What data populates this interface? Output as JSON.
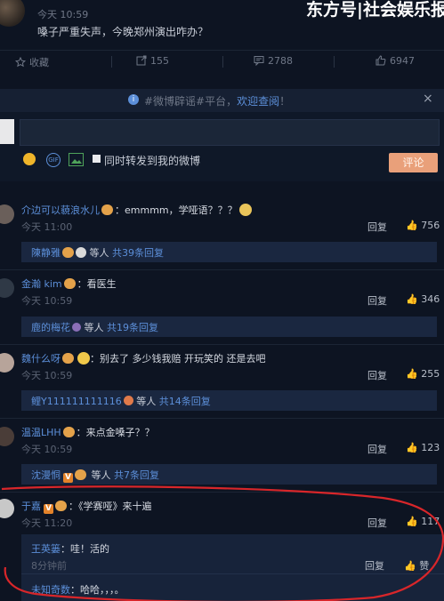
{
  "header": {
    "watermark": "东方号|社会娱乐报",
    "time": "今天 10:59",
    "post_text": "嗓子严重失声，今晚郑州演出咋办？"
  },
  "actions": {
    "favorite_label": "收藏",
    "repost_count": "155",
    "comment_count": "2788",
    "like_count": "6947"
  },
  "notice": {
    "prefix": "#微博辟谣#平台，",
    "link": "欢迎查阅",
    "suffix": "！",
    "close": "×"
  },
  "composer": {
    "repost_checkbox_label": "同时转发到我的微博",
    "submit_label": "评论"
  },
  "comments": [
    {
      "name": "介边可以藐浪水儿",
      "text": "：emmmm，学哑语？？？",
      "time": "今天 11:00",
      "reply": "回复",
      "likes": "756",
      "sub": {
        "users": "陳静雅",
        "suffix": " 等人 ",
        "count": "共39条回复"
      }
    },
    {
      "name": "金瀚 kim",
      "text": "：看医生",
      "time": "今天 10:59",
      "reply": "回复",
      "likes": "346",
      "sub": {
        "users": "鹿的梅花",
        "suffix": " 等人 ",
        "count": "共19条回复"
      }
    },
    {
      "name": "魏什么呀",
      "text": "：别去了 多少钱我赔 开玩笑的 还是去吧",
      "time": "今天 10:59",
      "reply": "回复",
      "likes": "255",
      "sub": {
        "users": "鲤Y111111111116",
        "suffix": " 等人 ",
        "count": "共14条回复"
      }
    },
    {
      "name": "温温LHH",
      "text": "：来点金嗓子？？",
      "time": "今天 10:59",
      "reply": "回复",
      "likes": "123",
      "sub": {
        "users": "沈漫恫",
        "suffix": " 等人 ",
        "count": "共7条回复"
      }
    },
    {
      "name": "于嘉",
      "text": "：《学赛哑》来十遍",
      "time": "今天 11:20",
      "reply": "回复",
      "likes": "117"
    }
  ],
  "nested_replies": [
    {
      "name": "王英篓",
      "text": "：哇！活的",
      "time": "8分钟前",
      "reply": "回复",
      "like": "赞"
    },
    {
      "name": "未知奇数",
      "text": "：哈哈，，，。"
    }
  ],
  "colors": {
    "background": "#0d1422",
    "link": "#5c8fd9",
    "submit": "#e9a07a",
    "annotation": "#d8262a"
  }
}
